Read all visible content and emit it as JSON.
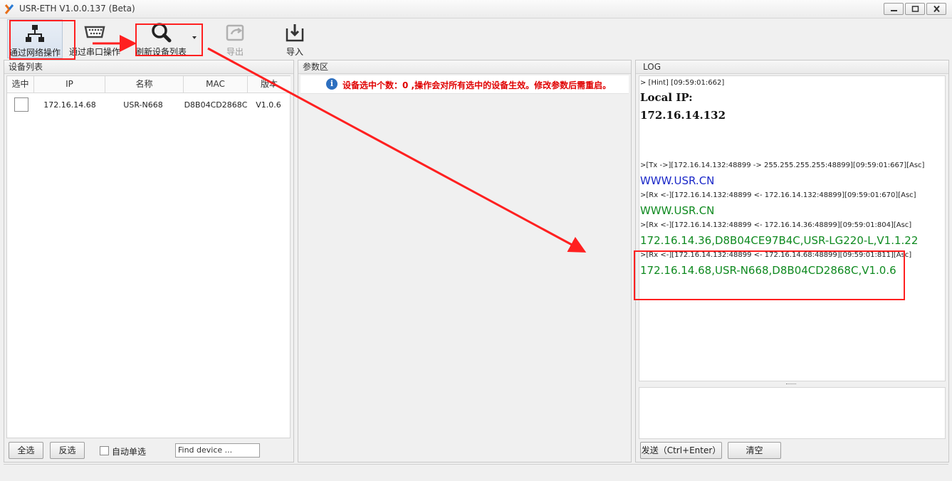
{
  "window": {
    "title": "USR-ETH V1.0.0.137 (Beta)"
  },
  "toolbar": {
    "network": "通过网络操作",
    "serial": "通过串口操作",
    "refresh": "刷新设备列表",
    "export": "导出",
    "import": "导入"
  },
  "device_panel": {
    "title": "设备列表",
    "columns": [
      "选中",
      "IP",
      "名称",
      "MAC",
      "版本"
    ],
    "rows": [
      {
        "ip": "172.16.14.68",
        "name": "USR-N668",
        "mac": "D8B04CD2868C",
        "version": "V1.0.6"
      }
    ],
    "select_all": "全选",
    "invert": "反选",
    "auto_single": "自动单选",
    "find_placeholder": "Find device ..."
  },
  "param_panel": {
    "title": "参数区",
    "info": "设备选中个数：0 ,操作会对所有选中的设备生效。修改参数后需重启。"
  },
  "log_panel": {
    "title": "LOG",
    "lines": [
      "> [Hint] [09:59:01:662]",
      "Local IP:",
      "172.16.14.132",
      ">[Tx ->][172.16.14.132:48899 -> 255.255.255.255:48899][09:59:01:667][Asc]",
      "WWW.USR.CN",
      ">[Rx <-][172.16.14.132:48899 <- 172.16.14.132:48899][09:59:01:670][Asc]",
      "WWW.USR.CN",
      ">[Rx <-][172.16.14.132:48899 <- 172.16.14.36:48899][09:59:01:804][Asc]",
      "172.16.14.36,D8B04CE97B4C,USR-LG220-L,V1.1.22",
      ">[Rx <-][172.16.14.132:48899 <- 172.16.14.68:48899][09:59:01:811][Asc]",
      "172.16.14.68,USR-N668,D8B04CD2868C,V1.0.6"
    ],
    "send": "发送（Ctrl+Enter）",
    "clear": "清空"
  },
  "colors": {
    "annotation": "#ff2020",
    "log_blue": "#1a28c8",
    "log_green": "#0f8a20",
    "info_red": "#e00000"
  }
}
